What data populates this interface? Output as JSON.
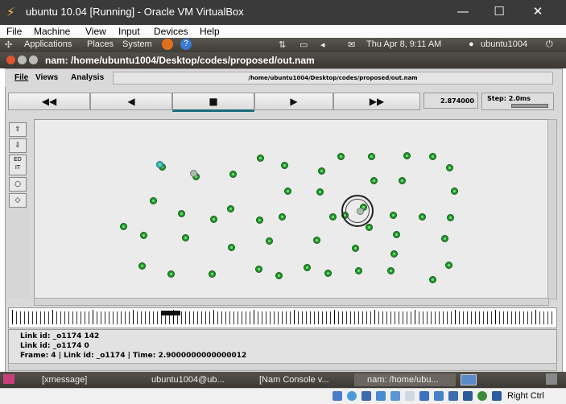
{
  "vbox": {
    "title": "ubuntu 10.04 [Running] - Oracle VM VirtualBox",
    "menu": [
      "File",
      "Machine",
      "View",
      "Input",
      "Devices",
      "Help"
    ],
    "host_key": "Right Ctrl"
  },
  "gnome_panel": {
    "menus": [
      "Applications",
      "Places",
      "System"
    ],
    "clock": "Thu Apr 8,  9:11 AM",
    "user": "ubuntu1004"
  },
  "nam": {
    "window_title": "nam: /home/ubuntu1004/Desktop/codes/proposed/out.nam",
    "menu": [
      "File",
      "Views",
      "Analysis"
    ],
    "path": "/home/ubuntu1004/Desktop/codes/proposed/out.nam",
    "controls": {
      "rewind": "◀◀",
      "back": "◀",
      "stop": "■",
      "play": "▶",
      "forward": "▶▶"
    },
    "time": "2.874000",
    "step": "Step: 2.0ms",
    "info_lines": [
      "Link id:  _o1174 142",
      "Link id:  _o1174 0",
      "Frame: 4 | Link id:  _o1174 | Time: 2.9000000000000012"
    ]
  },
  "taskbar": {
    "tasks": [
      "[xmessage]",
      "ubuntu1004@ub...",
      "[Nam Console v...",
      "nam: /home/ubu..."
    ]
  },
  "colors": {
    "node_green": "#1f9a28",
    "highlight_node": "#2fb8c8",
    "canvas": "#ebebeb"
  }
}
